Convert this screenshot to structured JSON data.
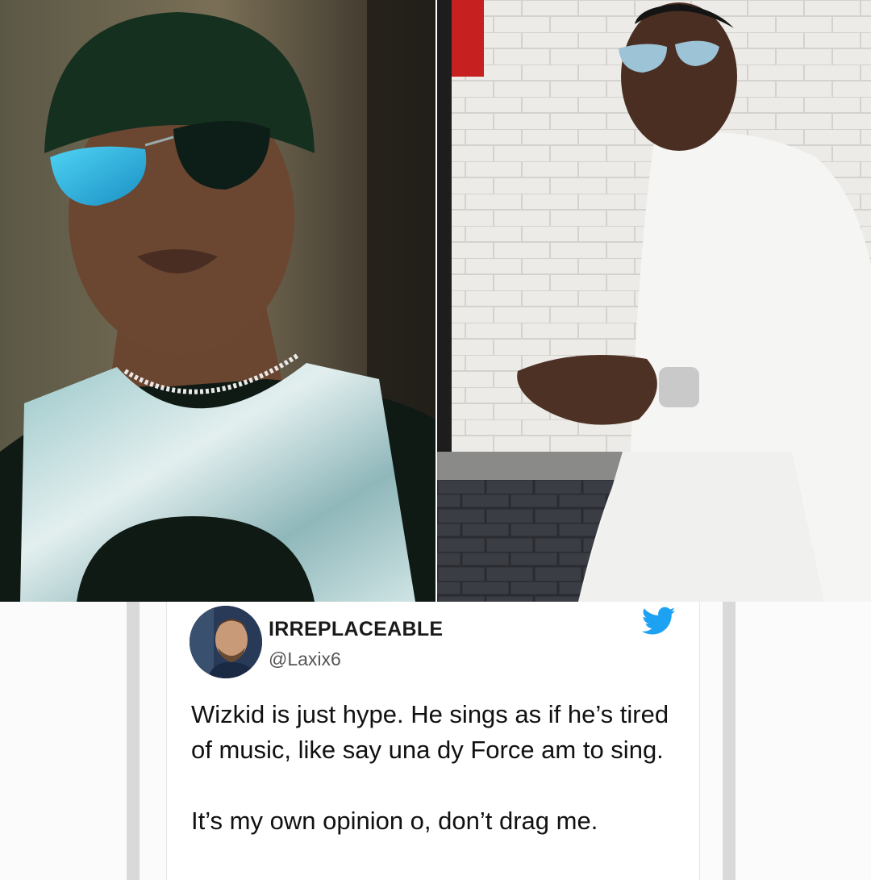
{
  "tweet": {
    "display_name": "IRREPLACEABLE",
    "handle": "@Laxix6",
    "paragraphs": [
      "Wizkid is just hype. He sings as if he’s tired of music, like say una dy Force am to sing.",
      "It’s my own opinion o, don’t drag me."
    ],
    "icon": "twitter-bird-icon",
    "accent_color": "#1DA1F2"
  },
  "photos": {
    "left_icon": "portrait-photo",
    "right_icon": "portrait-photo"
  }
}
